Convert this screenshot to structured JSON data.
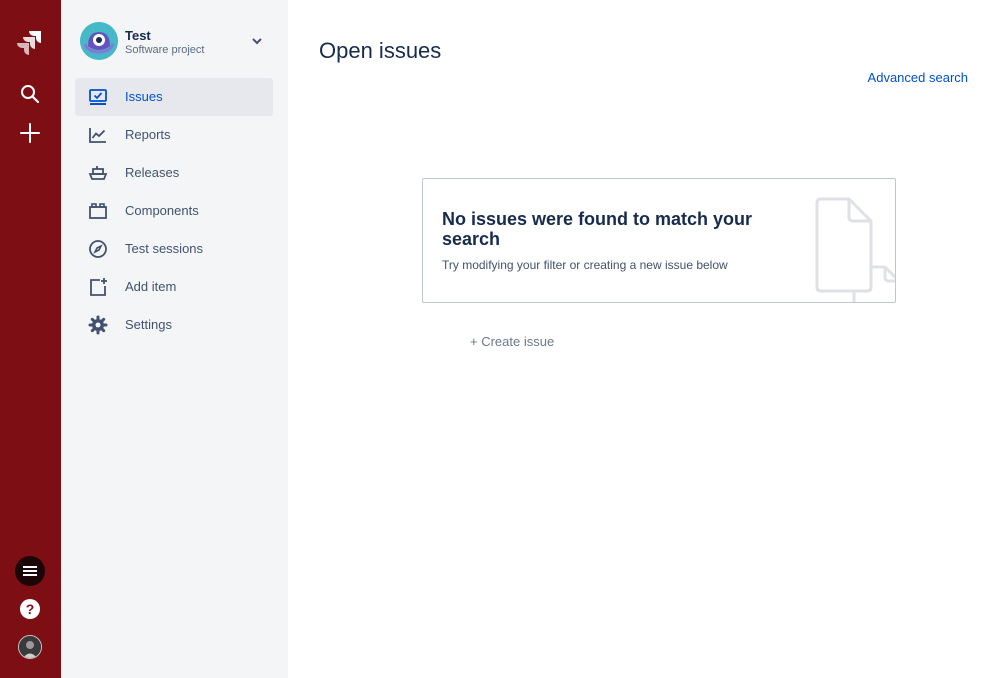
{
  "global_nav": {
    "items": [
      "jira-logo",
      "search",
      "create",
      "menu",
      "help",
      "profile"
    ]
  },
  "project": {
    "name": "Test",
    "type": "Software project"
  },
  "sidebar": {
    "items": [
      {
        "label": "Issues",
        "icon": "issues-icon",
        "active": true
      },
      {
        "label": "Reports",
        "icon": "reports-icon"
      },
      {
        "label": "Releases",
        "icon": "releases-icon"
      },
      {
        "label": "Components",
        "icon": "components-icon"
      },
      {
        "label": "Test sessions",
        "icon": "compass-icon"
      },
      {
        "label": "Add item",
        "icon": "add-item-icon"
      },
      {
        "label": "Settings",
        "icon": "gear-icon"
      }
    ]
  },
  "main": {
    "title": "Open issues",
    "advanced_search": "Advanced search",
    "empty_state": {
      "title": "No issues were found to match your search",
      "description": "Try modifying your filter or creating a new issue below"
    },
    "create_issue": "+ Create issue"
  },
  "colors": {
    "global_nav_bg": "#7d0f14",
    "sidebar_bg": "#f4f5f7",
    "link": "#0052cc",
    "text": "#172b4d"
  }
}
